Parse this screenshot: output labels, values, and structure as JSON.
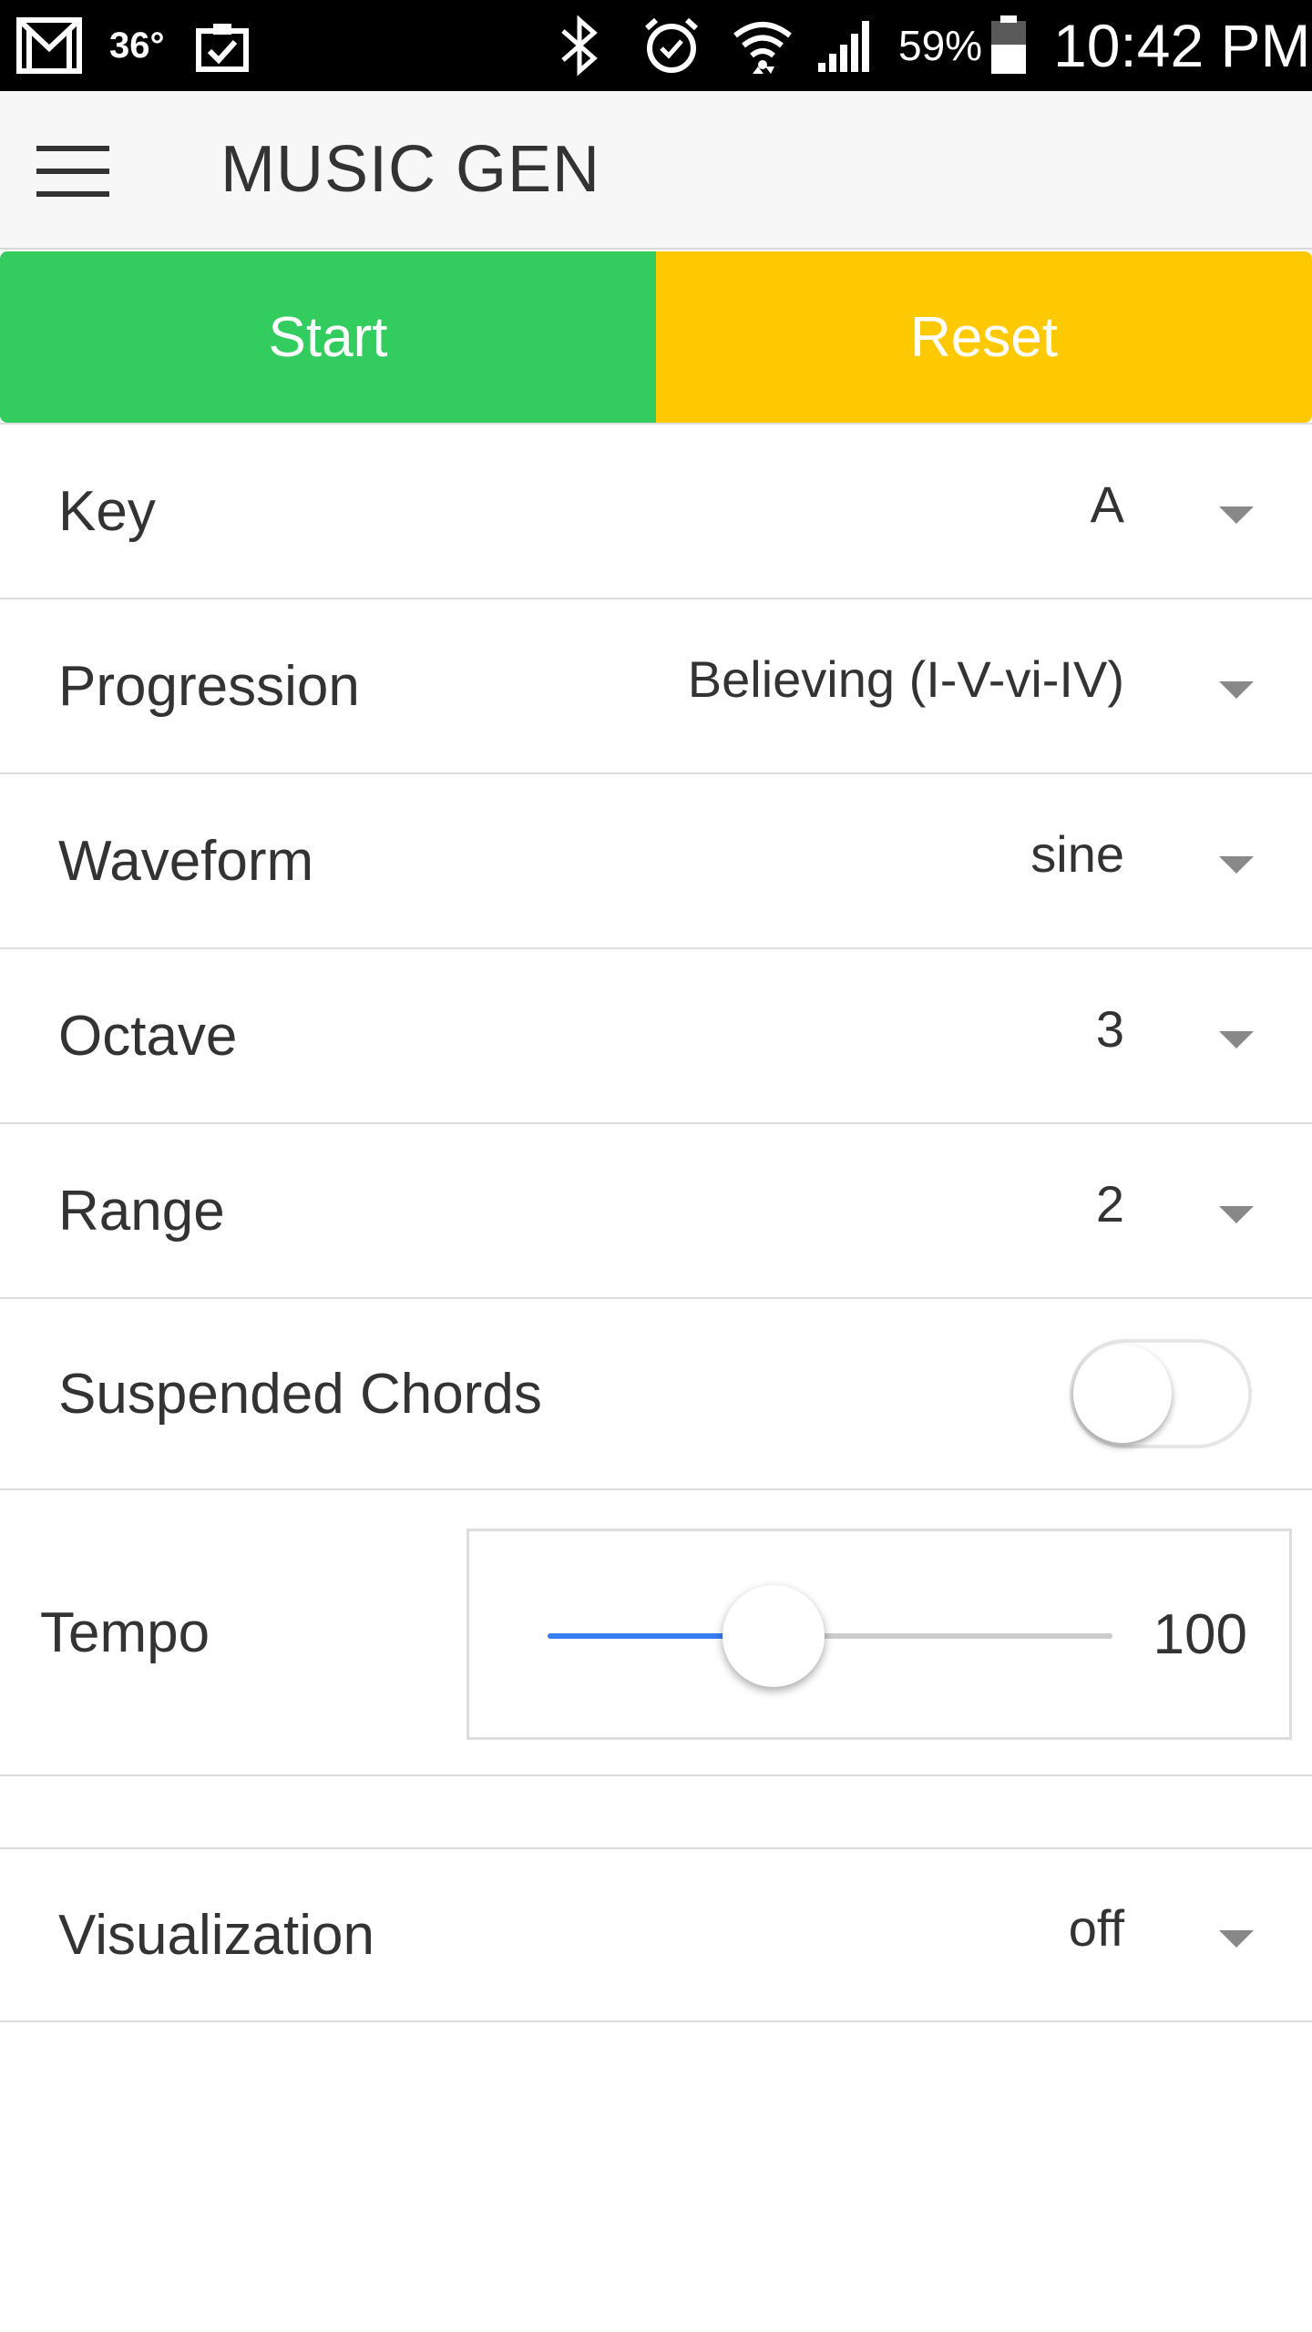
{
  "status_bar": {
    "left_icons": [
      "gmail-icon",
      "temperature",
      "clipboard-check-icon"
    ],
    "temperature": "36°",
    "right_icons": [
      "bluetooth-icon",
      "alarm-icon",
      "wifi-icon",
      "signal-icon",
      "battery-icon"
    ],
    "battery_percent": "59%",
    "time": "10:42 PM"
  },
  "app_bar": {
    "menu_icon": "hamburger-menu-icon",
    "title": "MUSIC GEN"
  },
  "actions": {
    "start_label": "Start",
    "reset_label": "Reset",
    "start_color": "#33cd5f",
    "reset_color": "#ffc900"
  },
  "settings": {
    "key": {
      "label": "Key",
      "value": "A"
    },
    "progression": {
      "label": "Progression",
      "value": "Believing (I-V-vi-IV)"
    },
    "waveform": {
      "label": "Waveform",
      "value": "sine"
    },
    "octave": {
      "label": "Octave",
      "value": "3"
    },
    "range": {
      "label": "Range",
      "value": "2"
    },
    "suspended_chords": {
      "label": "Suspended Chords",
      "enabled": false
    },
    "tempo": {
      "label": "Tempo",
      "value": "100",
      "slider_fraction": 0.4
    },
    "visualization": {
      "label": "Visualization",
      "value": "off"
    }
  },
  "colors": {
    "slider_accent": "#387ef5"
  }
}
